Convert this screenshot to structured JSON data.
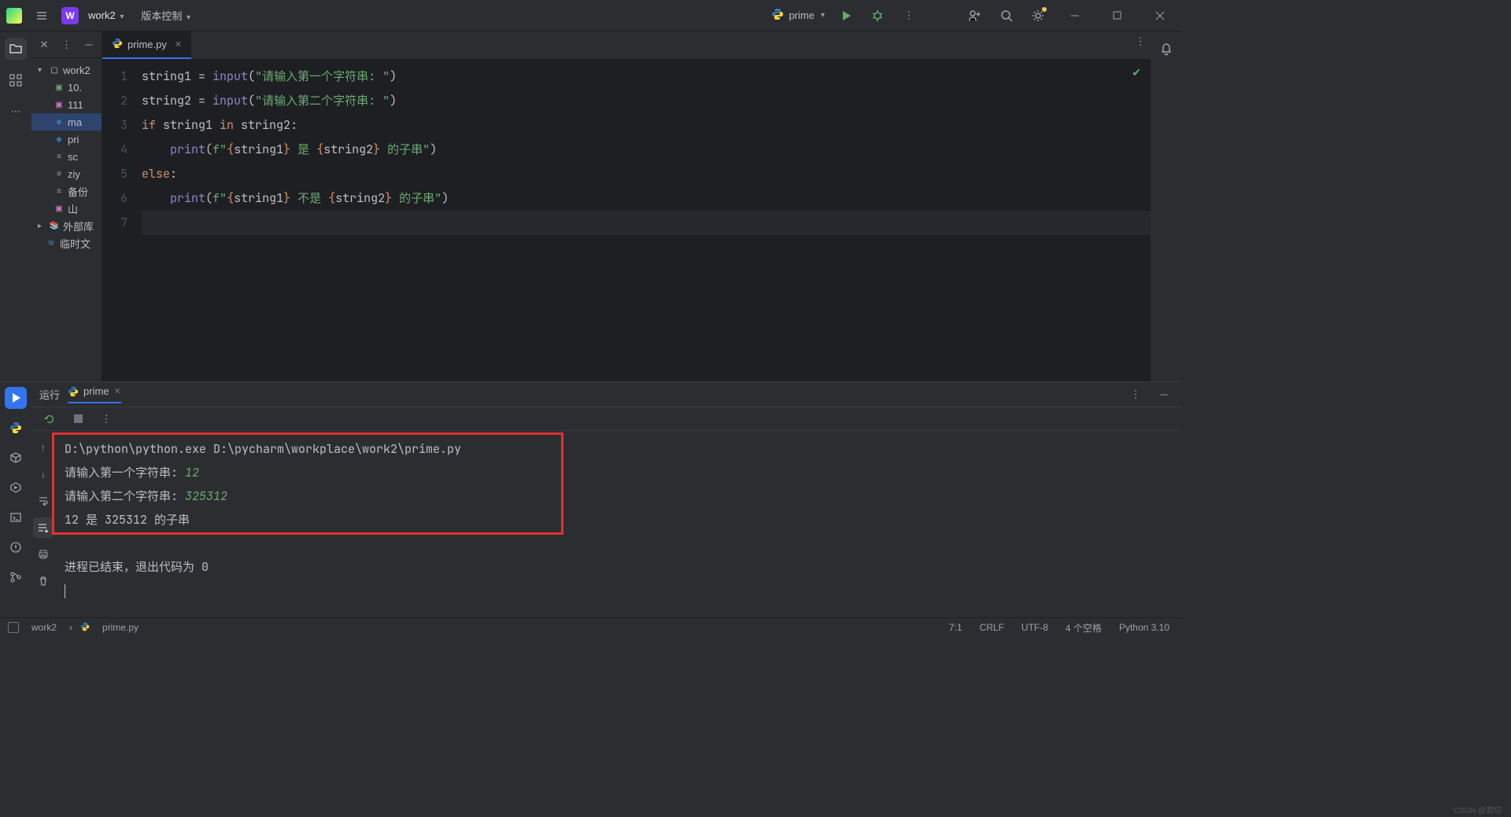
{
  "titlebar": {
    "project_name": "work2",
    "vcs_label": "版本控制",
    "run_config": "prime"
  },
  "project_tree": {
    "root": "work2",
    "items": [
      {
        "icon": "md",
        "label": "10."
      },
      {
        "icon": "json",
        "label": "111"
      },
      {
        "icon": "py",
        "label": "ma",
        "selected": true
      },
      {
        "icon": "py",
        "label": "pri"
      },
      {
        "icon": "txt",
        "label": "sc"
      },
      {
        "icon": "txt",
        "label": "ziy"
      },
      {
        "icon": "txt",
        "label": "备份"
      },
      {
        "icon": "json",
        "label": "山"
      }
    ],
    "external": "外部库",
    "scratch": "临时文"
  },
  "editor": {
    "tab_name": "prime.py",
    "line_numbers": [
      "1",
      "2",
      "3",
      "4",
      "5",
      "6",
      "7"
    ],
    "code": {
      "l1_var": "string1 ",
      "l1_op": "= ",
      "l1_fn": "input",
      "l1_paren_o": "(",
      "l1_str": "\"请输入第一个字符串: \"",
      "l1_paren_c": ")",
      "l2_var": "string2 ",
      "l2_op": "= ",
      "l2_fn": "input",
      "l2_paren_o": "(",
      "l2_str": "\"请输入第二个字符串: \"",
      "l2_paren_c": ")",
      "l3_if": "if ",
      "l3_v1": "string1 ",
      "l3_in": "in ",
      "l3_v2": "string2",
      "l3_colon": ":",
      "l4_indent": "    ",
      "l4_print": "print",
      "l4_po": "(",
      "l4_f": "f\"",
      "l4_bo1": "{",
      "l4_fv1": "string1",
      "l4_bc1": "}",
      "l4_mid": " 是 ",
      "l4_bo2": "{",
      "l4_fv2": "string2",
      "l4_bc2": "}",
      "l4_end": " 的子串\"",
      "l4_pc": ")",
      "l5_else": "else",
      "l5_colon": ":",
      "l6_indent": "    ",
      "l6_print": "print",
      "l6_po": "(",
      "l6_f": "f\"",
      "l6_bo1": "{",
      "l6_fv1": "string1",
      "l6_bc1": "}",
      "l6_mid": " 不是 ",
      "l6_bo2": "{",
      "l6_fv2": "string2",
      "l6_bc2": "}",
      "l6_end": " 的子串\"",
      "l6_pc": ")"
    }
  },
  "console": {
    "run_label": "运行",
    "tab_name": "prime",
    "output": {
      "path": "D:\\python\\python.exe D:\\pycharm\\workplace\\work2\\prime.py",
      "prompt1": "请输入第一个字符串: ",
      "input1": "12",
      "prompt2": "请输入第二个字符串: ",
      "input2": "325312",
      "result": "12 是 325312 的子串",
      "exit": "进程已结束，退出代码为 0"
    }
  },
  "breadcrumb": {
    "project": "work2",
    "file": "prime.py"
  },
  "statusbar": {
    "pos": "7:1",
    "crlf": "CRLF",
    "encoding": "UTF-8",
    "indent": "4 个空格",
    "python": "Python 3.10"
  },
  "watermark": "CSDN @君切"
}
